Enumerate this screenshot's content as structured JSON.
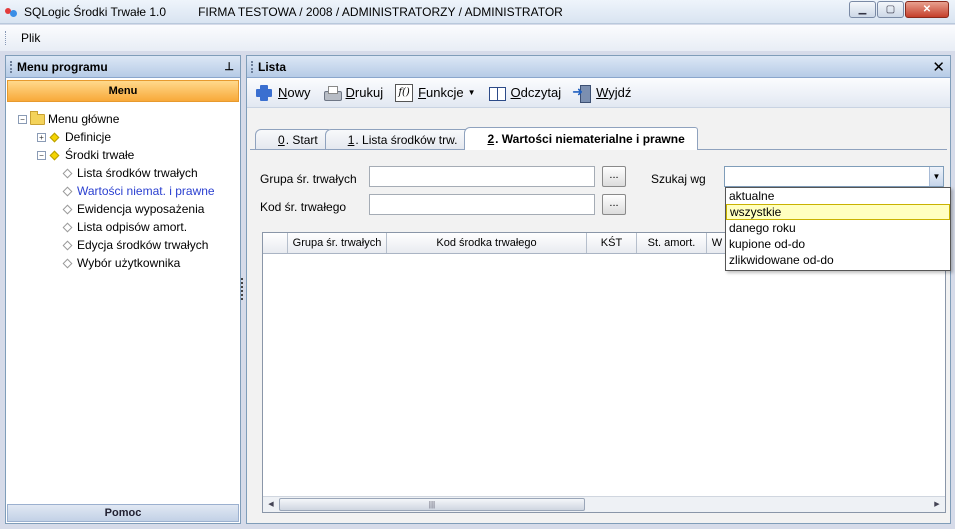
{
  "window": {
    "app_name": "SQLogic Środki Trwałe 1.0",
    "title_info": "FIRMA TESTOWA / 2008 / ADMINISTRATORZY /  ADMINISTRATOR",
    "minimize": "▁",
    "maximize": "▢",
    "close": "✕"
  },
  "menubar": {
    "items": [
      {
        "label": "Plik"
      }
    ]
  },
  "left_panel": {
    "title": "Menu programu",
    "pin": "⊥",
    "section": "Menu",
    "footer": "Pomoc",
    "tree": {
      "root": "Menu główne",
      "definicje": "Definicje",
      "srodki": "Środki trwałe",
      "leaves": [
        "Lista środków trwałych",
        "Wartości niemat. i prawne",
        "Ewidencja wyposażenia",
        "Lista odpisów amort.",
        "Edycja środków trwałych",
        "Wybór użytkownika"
      ],
      "selected_index": 1
    }
  },
  "right_panel": {
    "title": "Lista",
    "close": "✕",
    "toolbar": {
      "nowy": "Nowy",
      "drukuj": "Drukuj",
      "funkcje": "Funkcje",
      "odczytaj": "Odczytaj",
      "wyjdz": "Wyjdź",
      "fx": "f()"
    },
    "tabs": [
      {
        "num": "0",
        "label": ". Start"
      },
      {
        "num": "1",
        "label": ". Lista środków trw."
      },
      {
        "num": "2",
        "label": ". Wartości niematerialne i prawne"
      }
    ],
    "active_tab": 2,
    "form": {
      "grupa_label": "Grupa śr. trwałych",
      "kod_label": "Kod śr. trwałego",
      "szukaj_label": "Szukaj wg",
      "grupa_value": "",
      "kod_value": "",
      "szukaj_value": "",
      "dots": "...",
      "combo_arrow": "▼"
    },
    "dropdown_options": [
      "aktualne",
      "wszystkie",
      "danego roku",
      "kupione od-do",
      "zlikwidowane od-do"
    ],
    "dropdown_highlighted": 1,
    "grid": {
      "columns": [
        "",
        "Grupa śr. trwałych",
        "Kod środka trwałego",
        "KŚT",
        "St. amort.",
        "W"
      ],
      "rows": [],
      "scroll_left": "◀",
      "scroll_right": "▶",
      "thumb_grip": "|||"
    }
  },
  "colors": {
    "accent_orange": "#f8a93a",
    "header_blue": "#b6cbe6",
    "selected_text": "#2a3fd0",
    "dropdown_highlight": "#ffffbf"
  }
}
